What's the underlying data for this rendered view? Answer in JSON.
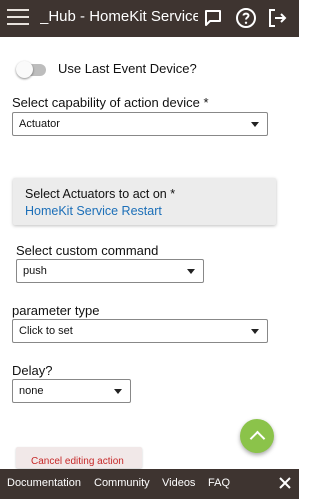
{
  "header": {
    "title": "_Hub - HomeKit Service Re",
    "icons": [
      "menu-icon",
      "chat-bubble-icon",
      "help-circle-icon",
      "logout-icon"
    ]
  },
  "toggle": {
    "label": "Use Last Event Device?",
    "on": false
  },
  "capability": {
    "label": "Select capability of action device *",
    "value": "Actuator"
  },
  "actuators": {
    "heading": "Select Actuators to act on *",
    "selected": "HomeKit Service Restart"
  },
  "command": {
    "label": "Select custom command",
    "value": "push"
  },
  "param_type": {
    "label": "parameter type",
    "value": "Click to set"
  },
  "delay": {
    "label": "Delay?",
    "value": "none"
  },
  "cancel_button": {
    "label": "Cancel editing action"
  },
  "fab": {
    "icon": "chevron-up-icon",
    "color": "#8bc34a"
  },
  "footer": {
    "links": [
      "Documentation",
      "Community",
      "Videos",
      "FAQ"
    ],
    "close_icon": "close-icon"
  },
  "colors": {
    "bar": "#3e3430",
    "link": "#1c6fb8",
    "danger": "#c62828"
  }
}
